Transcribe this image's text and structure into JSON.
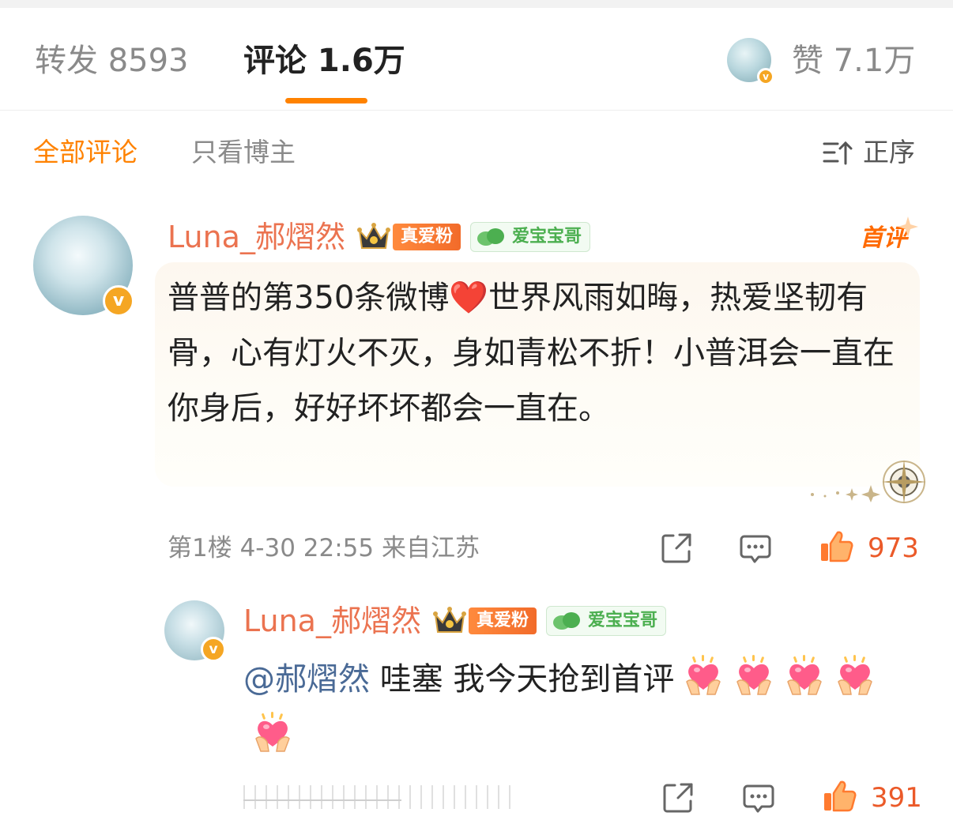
{
  "tabs": {
    "forward_label": "转发 8593",
    "comment_label": "评论 1.6万",
    "like_label": "赞 7.1万"
  },
  "filters": {
    "all_label": "全部评论",
    "owner_label": "只看博主",
    "sort_label": "正序"
  },
  "colors": {
    "accent": "#ff8200",
    "username": "#eb7350",
    "like_count": "#eb5a29",
    "mention": "#4a6a96"
  },
  "comment": {
    "username": "Luna_郝熠然",
    "fan_badge": "真爱粉",
    "group_badge": "爱宝宝哥",
    "first_badge": "首评",
    "text_before_heart": "普普的第350条微博",
    "heart_glyph": "❤️",
    "text_after_heart": "世界风雨如晦，热爱坚韧有骨，心有灯火不灭，身如青松不折！小普洱会一直在你身后，好好坏坏都会一直在。",
    "meta": "第1楼 4-30 22:55 来自江苏",
    "likes": "973",
    "verified_badge": "v"
  },
  "reply": {
    "username": "Luna_郝熠然",
    "fan_badge": "真爱粉",
    "group_badge": "爱宝宝哥",
    "mention": "@郝熠然",
    "text": " 哇塞 我今天抢到首评",
    "heart_emoji_count": 5,
    "likes": "391",
    "verified_badge": "v"
  },
  "tab_header_badge": "v",
  "icons": [
    "sort-icon",
    "crown-icon",
    "leaf-icon",
    "share-icon",
    "comment-icon",
    "thumbs-up-icon",
    "heart-hands-icon",
    "compass-icon",
    "star-icon"
  ]
}
